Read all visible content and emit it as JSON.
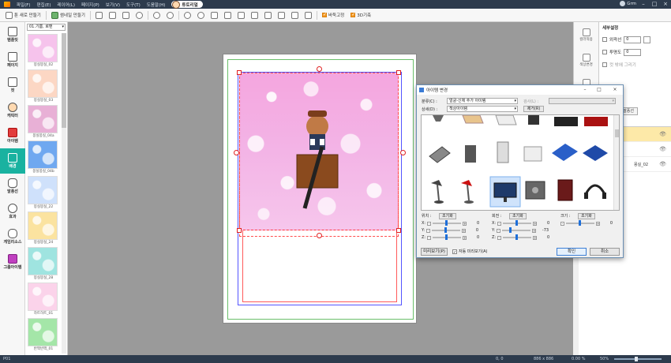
{
  "menu": {
    "items": [
      "파일(F)",
      "편집(E)",
      "레이어(L)",
      "페이지(P)",
      "보기(V)",
      "도구(T)",
      "도움말(H)"
    ],
    "tutorial_label": "튜토리얼",
    "user_name": "Grm"
  },
  "toolbar": {
    "new_toon_label": "툰 새로 만들기",
    "thumbnail_label": "썸네일 만들기",
    "snap_label": "바둑고정",
    "view3d_label": "3D기축"
  },
  "left_nav": [
    {
      "label": "템플릿"
    },
    {
      "label": "페이지"
    },
    {
      "label": "컷"
    },
    {
      "label": "캐릭터"
    },
    {
      "label": "아이템"
    },
    {
      "label": "배경"
    },
    {
      "label": "말풍선"
    },
    {
      "label": "효과"
    },
    {
      "label": "게임리소스"
    },
    {
      "label": "그룹아이템"
    }
  ],
  "assets": {
    "category": "01.기쁨, 로맨",
    "thumbs": [
      {
        "caption": "몽실몽실_02",
        "color": "#f6c3ec"
      },
      {
        "caption": "몽실몽실_03",
        "color": "#fcd7c4"
      },
      {
        "caption": "몽실몽실_04a",
        "color": "#e8b0d6"
      },
      {
        "caption": "몽실몽실_04b",
        "color": "#6fa8f0"
      },
      {
        "caption": "몽실몽실_22",
        "color": "#cfe1fb"
      },
      {
        "caption": "몽실몽실_24",
        "color": "#fbe3a0"
      },
      {
        "caption": "몽실몽실_28",
        "color": "#9fe4e0"
      },
      {
        "caption": "하트하트_01",
        "color": "#fbd3ea"
      },
      {
        "caption": "반짝반짝_01",
        "color": "#a4e6a8"
      }
    ]
  },
  "right_icons": [
    {
      "label": "컬러적용"
    },
    {
      "label": "색상변경"
    },
    {
      "label": "각도변경"
    }
  ],
  "detail": {
    "title": "세부설정",
    "outline_label": "외곽선",
    "outline_value": "0",
    "opacity_label": "투명도",
    "opacity_value": "0",
    "cut_outside_label": "컷 밖에 그리기",
    "apply_button": "맞 말풍선"
  },
  "layers": [
    {
      "name": "",
      "selected": true
    },
    {
      "name": "",
      "selected": false
    },
    {
      "name": "몽실_02",
      "selected": false
    }
  ],
  "status": {
    "left": "P01",
    "coords": "0, 0",
    "size": "886 x 886",
    "zoom_pos": "0.00 %",
    "zoom": "50%"
  },
  "dialog": {
    "title": "아이템 변경",
    "category_label": "분류(C) :",
    "category_value": "얼굴-신체 추가 아이템",
    "detail_label": "상세(D) :",
    "detail_value": "책상아이템",
    "search_label": "검사(L) :",
    "remove_button": "제거(R)",
    "position_label": "위치 :",
    "rotation_label": "회전 :",
    "size_label": "크기 :",
    "reset_label": "초기화",
    "pos_values": {
      "x": "0",
      "y": "0",
      "z": "0"
    },
    "rot_values": {
      "x": "0",
      "y": "-73",
      "z": "0"
    },
    "size_value": "0",
    "preview_button": "미리보기(P)",
    "auto_preview_label": "자동 미리보기(A)",
    "ok_button": "확인",
    "cancel_button": "취소",
    "items": [
      {
        "icon": "lamp-icon"
      },
      {
        "icon": "desk-icon"
      },
      {
        "icon": "desk-icon"
      },
      {
        "icon": "office-chair-icon"
      },
      {
        "icon": "sofa-icon"
      },
      {
        "icon": "sofa-icon"
      },
      {
        "icon": "scanner-icon"
      },
      {
        "icon": "folding-chair-icon"
      },
      {
        "icon": "computer-tower-icon"
      },
      {
        "icon": "printer-icon"
      },
      {
        "icon": "notebook-icon"
      },
      {
        "icon": "notebook-icon"
      },
      {
        "icon": "desk-lamp-icon"
      },
      {
        "icon": "desk-lamp-icon"
      },
      {
        "icon": "monitor-icon"
      },
      {
        "icon": "safe-icon"
      },
      {
        "icon": "book-icon"
      },
      {
        "icon": "headset-icon"
      }
    ]
  }
}
